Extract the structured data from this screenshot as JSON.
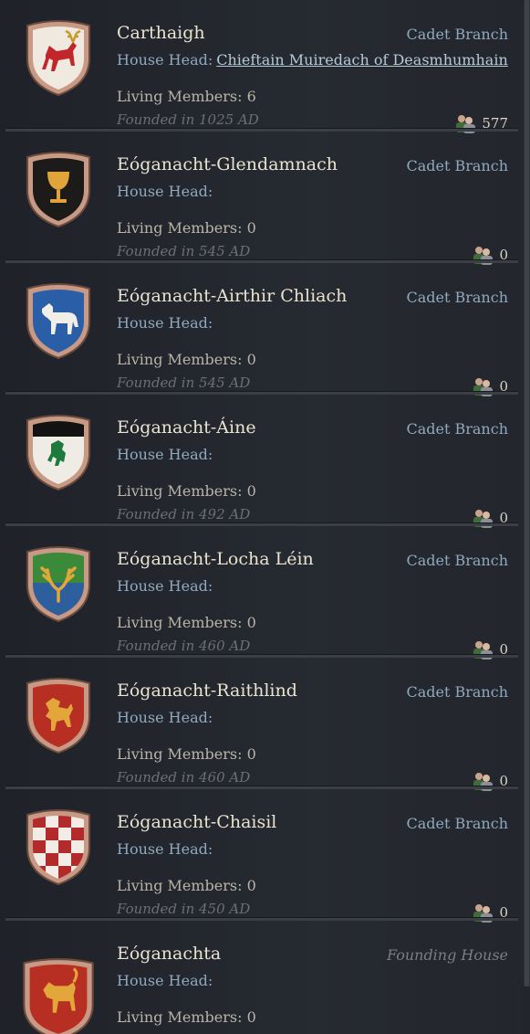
{
  "houses": [
    {
      "name": "Carthaigh",
      "type": "Cadet Branch",
      "head_label": "House Head:",
      "head_name": "Chieftain Muiredach of Deasmhumhain",
      "living": "Living Members: 6",
      "founded": "Founded in 1025 AD",
      "count": "577",
      "emblem": "stag"
    },
    {
      "name": "Eóganacht-Glendamnach",
      "type": "Cadet Branch",
      "head_label": "House Head:",
      "head_name": "",
      "living": "Living Members: 0",
      "founded": "Founded in 545 AD",
      "count": "0",
      "emblem": "chalice"
    },
    {
      "name": "Eóganacht-Airthir Chliach",
      "type": "Cadet Branch",
      "head_label": "House Head:",
      "head_name": "",
      "living": "Living Members: 0",
      "founded": "Founded in 545 AD",
      "count": "0",
      "emblem": "horse"
    },
    {
      "name": "Eóganacht-Áine",
      "type": "Cadet Branch",
      "head_label": "House Head:",
      "head_name": "",
      "living": "Living Members: 0",
      "founded": "Founded in 492 AD",
      "count": "0",
      "emblem": "green-lion"
    },
    {
      "name": "Eóganacht-Locha Léin",
      "type": "Cadet Branch",
      "head_label": "House Head:",
      "head_name": "",
      "living": "Living Members: 0",
      "founded": "Founded in 460 AD",
      "count": "0",
      "emblem": "antlers"
    },
    {
      "name": "Eóganacht-Raithlind",
      "type": "Cadet Branch",
      "head_label": "House Head:",
      "head_name": "",
      "living": "Living Members: 0",
      "founded": "Founded in 460 AD",
      "count": "0",
      "emblem": "gold-lion"
    },
    {
      "name": "Eóganacht-Chaisil",
      "type": "Cadet Branch",
      "head_label": "House Head:",
      "head_name": "",
      "living": "Living Members: 0",
      "founded": "Founded in 450 AD",
      "count": "0",
      "emblem": "checky"
    },
    {
      "name": "Eóganachta",
      "type": "Founding House",
      "head_label": "House Head:",
      "head_name": "",
      "living": "Living Members: 0",
      "founded": "",
      "count": "",
      "emblem": "goat"
    }
  ],
  "colors": {
    "shield_frame": "#c89a86",
    "cadet": "#8fa9bf",
    "founding": "#7a7e84"
  }
}
